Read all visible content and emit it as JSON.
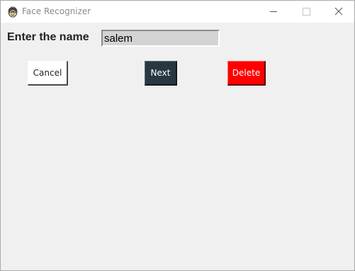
{
  "window": {
    "title": "Face Recognizer",
    "icon": "face-recognizer-app-icon",
    "controls": {
      "minimize_icon": "minimize-icon",
      "maximize_icon": "maximize-icon",
      "close_icon": "close-icon"
    }
  },
  "form": {
    "name_label": "Enter the name",
    "name_value": "salem"
  },
  "buttons": {
    "cancel": "Cancel",
    "next": "Next",
    "delete": "Delete"
  },
  "colors": {
    "next_button_bg": "#283843",
    "delete_button_bg": "#ff0000",
    "cancel_button_bg": "#ffffff",
    "entry_bg": "#d3d3d3",
    "window_bg": "#f0f0f0"
  }
}
